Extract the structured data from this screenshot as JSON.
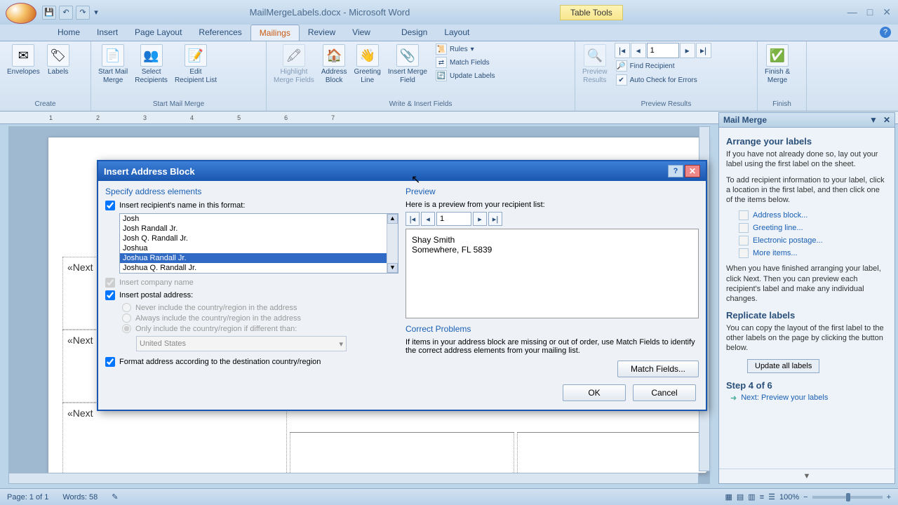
{
  "titlebar": {
    "doc_title": "MailMergeLabels.docx - Microsoft Word",
    "table_tools": "Table Tools"
  },
  "tabs": {
    "home": "Home",
    "insert": "Insert",
    "pagelayout": "Page Layout",
    "references": "References",
    "mailings": "Mailings",
    "review": "Review",
    "view": "View",
    "design": "Design",
    "layout": "Layout"
  },
  "ribbon": {
    "create_label": "Create",
    "envelopes": "Envelopes",
    "labels": "Labels",
    "startmm_label": "Start Mail Merge",
    "startmm": "Start Mail\nMerge",
    "selectrec": "Select\nRecipients",
    "editrec": "Edit\nRecipient List",
    "wif_label": "Write & Insert Fields",
    "highlight": "Highlight\nMerge Fields",
    "addrblock": "Address\nBlock",
    "greeting": "Greeting\nLine",
    "insertmf": "Insert Merge\nField",
    "rules": "Rules",
    "matchfields": "Match Fields",
    "updatelabels": "Update Labels",
    "preview_label": "Preview Results",
    "previewres": "Preview\nResults",
    "record_num": "1",
    "findrec": "Find Recipient",
    "autocheck": "Auto Check for Errors",
    "finish_label": "Finish",
    "finish": "Finish &\nMerge"
  },
  "ruler": [
    "1",
    "2",
    "3",
    "4",
    "5",
    "6",
    "7"
  ],
  "document": {
    "next_record": "«Next"
  },
  "taskpane": {
    "title": "Mail Merge",
    "arrange_h": "Arrange your labels",
    "arrange_p1": "If you have not already done so, lay out your label using the first label on the sheet.",
    "arrange_p2": "To add recipient information to your label, click a location in the first label, and then click one of the items below.",
    "link_addr": "Address block...",
    "link_greet": "Greeting line...",
    "link_epost": "Electronic postage...",
    "link_more": "More items...",
    "arrange_p3": "When you have finished arranging your label, click Next. Then you can preview each recipient's label and make any individual changes.",
    "replicate_h": "Replicate labels",
    "replicate_p": "You can copy the layout of the first label to the other labels on the page by clicking the button below.",
    "update_btn": "Update all labels",
    "step": "Step 4 of 6",
    "next_link": "Next: Preview your labels"
  },
  "dialog": {
    "title": "Insert Address Block",
    "specify_h": "Specify address elements",
    "chk_name": "Insert recipient's name in this format:",
    "name_opts": [
      "Josh",
      "Josh Randall Jr.",
      "Josh Q. Randall Jr.",
      "Joshua",
      "Joshua Randall Jr.",
      "Joshua Q. Randall Jr."
    ],
    "chk_company": "Insert company name",
    "chk_postal": "Insert postal address:",
    "r_never": "Never include the country/region in the address",
    "r_always": "Always include the country/region in the address",
    "r_only": "Only include the country/region if different than:",
    "country": "United States",
    "chk_format": "Format address according to the destination country/region",
    "preview_h": "Preview",
    "preview_lbl": "Here is a preview from your recipient list:",
    "preview_num": "1",
    "preview_name": "Shay Smith",
    "preview_addr": "Somewhere, FL 5839",
    "correct_h": "Correct Problems",
    "correct_p": "If items in your address block are missing or out of order, use Match Fields to identify the correct address elements from your mailing list.",
    "match_btn": "Match Fields...",
    "ok": "OK",
    "cancel": "Cancel"
  },
  "status": {
    "page": "Page: 1 of 1",
    "words": "Words: 58",
    "zoom": "100%"
  }
}
